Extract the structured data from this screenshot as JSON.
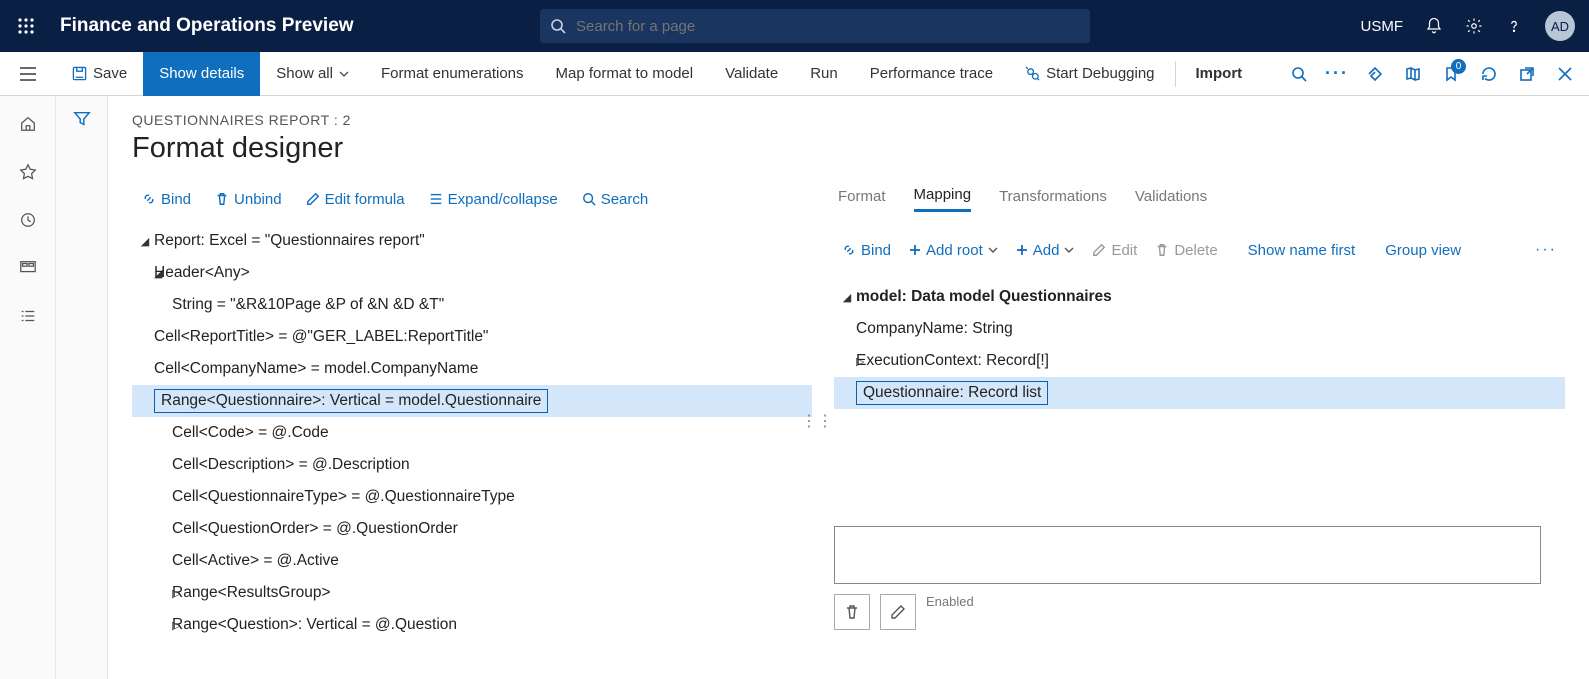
{
  "topbar": {
    "app_title": "Finance and Operations Preview",
    "search_placeholder": "Search for a page",
    "company": "USMF",
    "avatar": "AD"
  },
  "actionbar": {
    "save": "Save",
    "show_details": "Show details",
    "show_all": "Show all",
    "format_enum": "Format enumerations",
    "map_format": "Map format to model",
    "validate": "Validate",
    "run": "Run",
    "perf_trace": "Performance trace",
    "start_debug": "Start Debugging",
    "import": "Import",
    "badge": "0"
  },
  "header": {
    "breadcrumb": "QUESTIONNAIRES REPORT : 2",
    "title": "Format designer"
  },
  "left_toolbar": {
    "bind": "Bind",
    "unbind": "Unbind",
    "edit_formula": "Edit formula",
    "expand": "Expand/collapse",
    "search": "Search"
  },
  "left_tree": {
    "r0": "Report: Excel = \"Questionnaires report\"",
    "r1": "Header<Any>",
    "r2": "String = \"&R&10Page &P of &N &D &T\"",
    "r3": "Cell<ReportTitle> = @\"GER_LABEL:ReportTitle\"",
    "r4": "Cell<CompanyName> = model.CompanyName",
    "r5": "Range<Questionnaire>: Vertical = model.Questionnaire",
    "r6": "Cell<Code> = @.Code",
    "r7": "Cell<Description> = @.Description",
    "r8": "Cell<QuestionnaireType> = @.QuestionnaireType",
    "r9": "Cell<QuestionOrder> = @.QuestionOrder",
    "r10": "Cell<Active> = @.Active",
    "r11": "Range<ResultsGroup>",
    "r12": "Range<Question>: Vertical = @.Question"
  },
  "right_tabs": {
    "format": "Format",
    "mapping": "Mapping",
    "transformations": "Transformations",
    "validations": "Validations"
  },
  "right_toolbar": {
    "bind": "Bind",
    "add_root": "Add root",
    "add": "Add",
    "edit": "Edit",
    "delete": "Delete",
    "show_name": "Show name first",
    "group_view": "Group view"
  },
  "right_tree": {
    "m0": "model: Data model Questionnaires",
    "m1": "CompanyName: String",
    "m2": "ExecutionContext: Record[!]",
    "m3": "Questionnaire: Record list"
  },
  "bottom": {
    "enabled": "Enabled"
  }
}
